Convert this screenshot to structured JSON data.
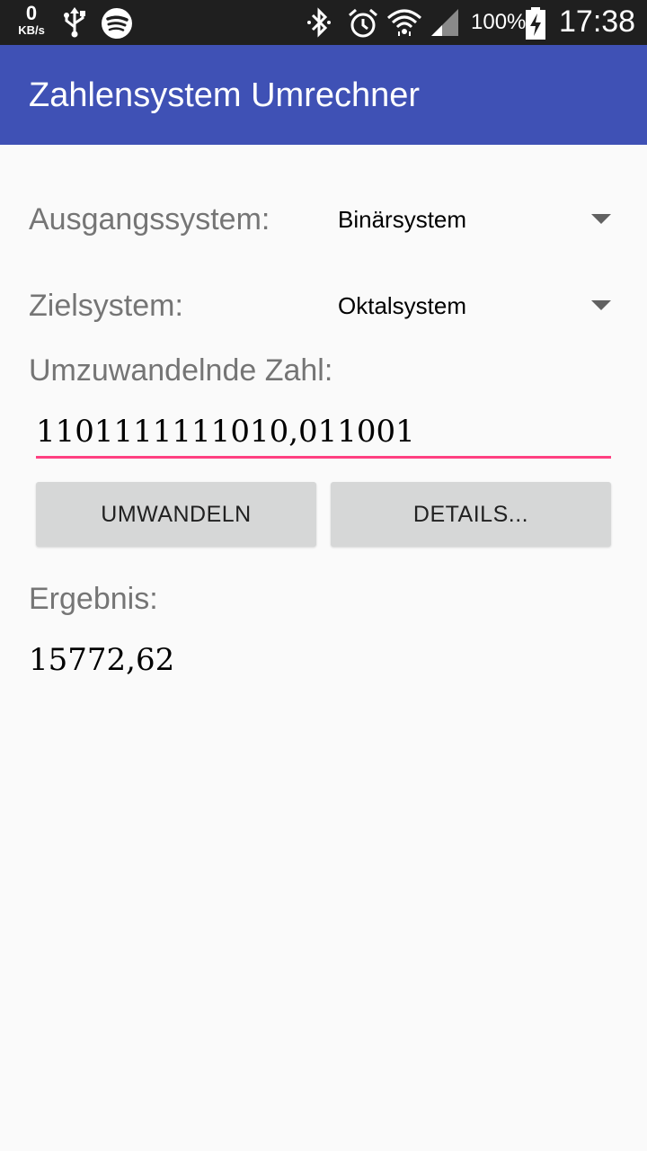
{
  "status_bar": {
    "net_speed_value": "0",
    "net_speed_unit": "KB/s",
    "battery_percent": "100%",
    "time": "17:38",
    "icons": [
      "usb-icon",
      "spotify-icon",
      "bluetooth-icon",
      "alarm-icon",
      "wifi-icon",
      "signal-icon",
      "battery-charging-icon"
    ]
  },
  "app_bar": {
    "title": "Zahlensystem Umrechner",
    "color": "#3f51b5"
  },
  "form": {
    "source_label": "Ausgangssystem:",
    "source_value": "Binärsystem",
    "target_label": "Zielsystem:",
    "target_value": "Oktalsystem",
    "number_label": "Umzuwandelnde Zahl:",
    "number_value": "1101111111010,011001",
    "accent_color": "#ff4081"
  },
  "buttons": {
    "convert_label": "UMWANDELN",
    "details_label": "DETAILS..."
  },
  "result": {
    "label": "Ergebnis:",
    "value": "15772,62"
  }
}
